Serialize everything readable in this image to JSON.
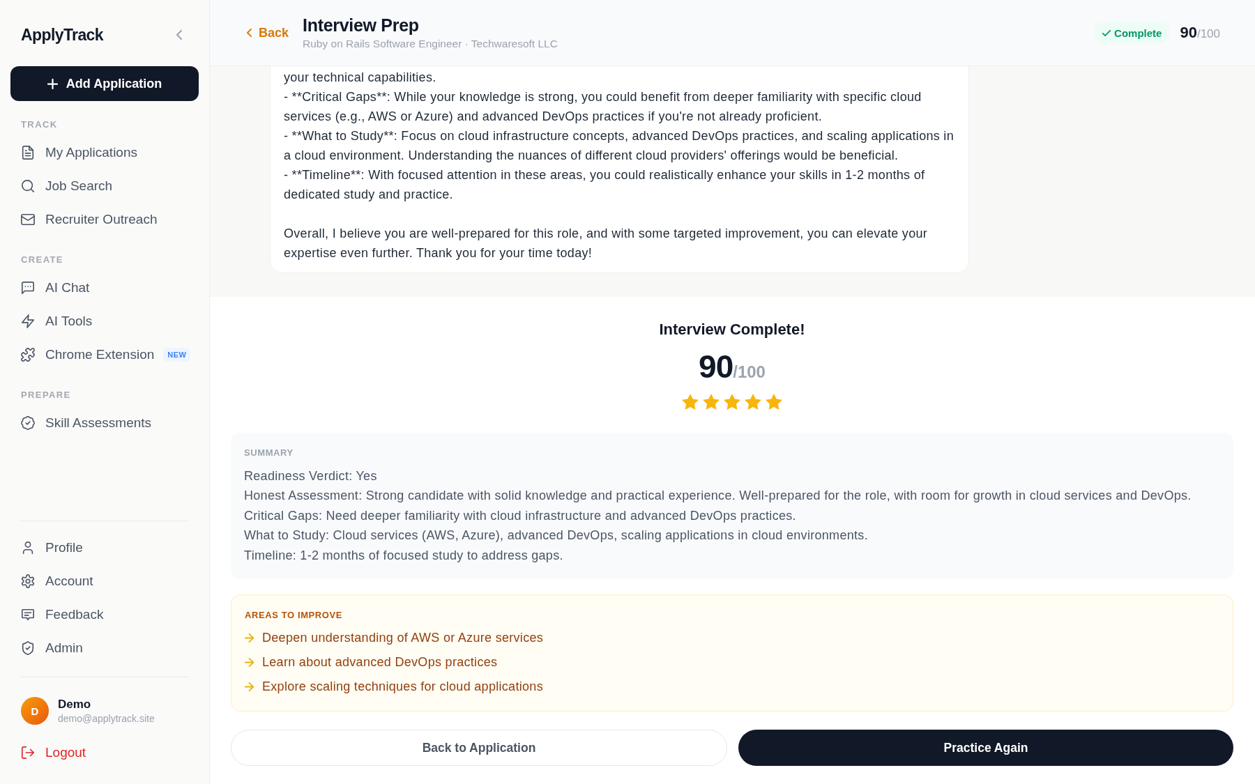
{
  "sidebar": {
    "logo": "ApplyTrack",
    "add_button": "Add Application",
    "sections": [
      {
        "heading": "TRACK",
        "items": [
          {
            "label": "My Applications",
            "selected": false
          },
          {
            "label": "Job Search",
            "selected": false
          },
          {
            "label": "Recruiter Outreach",
            "selected": false
          }
        ]
      },
      {
        "heading": "CREATE",
        "items": [
          {
            "label": "AI Chat",
            "selected": false
          },
          {
            "label": "AI Tools",
            "selected": false
          },
          {
            "label": "Chrome Extension",
            "badge": "NEW",
            "selected": false
          }
        ]
      },
      {
        "heading": "PREPARE",
        "items": [
          {
            "label": "Skill Assessments",
            "selected": false
          }
        ]
      }
    ],
    "bottom_items": [
      {
        "label": "Profile",
        "selected": false
      },
      {
        "label": "Account",
        "selected": false
      },
      {
        "label": "Feedback",
        "selected": false
      },
      {
        "label": "Admin",
        "selected": false
      }
    ],
    "user": {
      "initial": "D",
      "name": "Demo",
      "email": "demo@applytrack.site"
    },
    "logout": "Logout"
  },
  "header": {
    "back": "Back",
    "title": "Interview Prep",
    "subtitle": "Ruby on Rails Software Engineer · Techwaresoft LLC",
    "status": "Complete",
    "score": "90",
    "score_max": "/100"
  },
  "transcript": {
    "paragraphs": [
      {
        "lines": [
          "your technical capabilities.",
          "- **Critical Gaps**: While your knowledge is strong, you could benefit from deeper familiarity with specific cloud services (e.g., AWS or Azure) and advanced DevOps practices if you're not already proficient.",
          "- **What to Study**: Focus on cloud infrastructure concepts, advanced DevOps practices, and scaling applications in a cloud environment. Understanding the nuances of different cloud providers' offerings would be beneficial.",
          "- **Timeline**: With focused attention in these areas, you could realistically enhance your skills in 1-2 months of dedicated study and practice."
        ]
      },
      {
        "lines": [
          "Overall, I believe you are well-prepared for this role, and with some targeted improvement, you can elevate your expertise even further. Thank you for your time today!"
        ]
      }
    ]
  },
  "result": {
    "title": "Interview Complete!",
    "score": "90",
    "score_max": "/100",
    "stars": 5
  },
  "summary": {
    "label": "SUMMARY",
    "lines": [
      "Readiness Verdict: Yes",
      "Honest Assessment: Strong candidate with solid knowledge and practical experience. Well-prepared for the role, with room for growth in cloud services and DevOps.",
      "Critical Gaps: Need deeper familiarity with cloud infrastructure and advanced DevOps practices.",
      "What to Study: Cloud services (AWS, Azure), advanced DevOps, scaling applications in cloud environments.",
      "Timeline: 1-2 months of focused study to address gaps."
    ]
  },
  "areas_to_improve": {
    "label": "AREAS TO IMPROVE",
    "items": [
      "Deepen understanding of AWS or Azure services",
      "Learn about advanced DevOps practices",
      "Explore scaling techniques for cloud applications"
    ]
  },
  "actions": [
    {
      "label": "Back to Application",
      "kind": "secondary"
    },
    {
      "label": "Practice Again",
      "kind": "primary"
    }
  ]
}
